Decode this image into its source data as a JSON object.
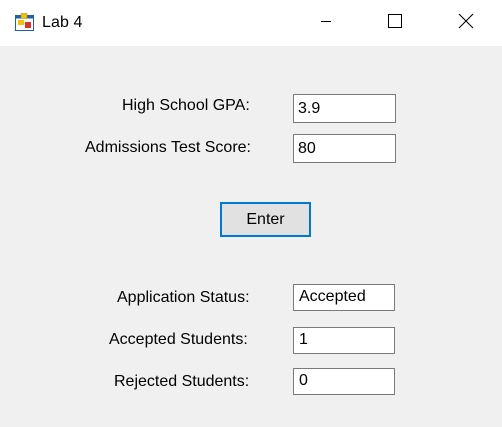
{
  "window": {
    "title": "Lab 4",
    "icon": "winforms-app-icon",
    "controls": {
      "minimize_icon": "minimize-icon",
      "maximize_icon": "maximize-icon",
      "close_icon": "close-icon"
    }
  },
  "form": {
    "gpa": {
      "label": "High School GPA:",
      "value": "3.9"
    },
    "test_score": {
      "label": "Admissions Test Score:",
      "value": "80"
    },
    "enter_button": {
      "label": "Enter"
    },
    "application_status": {
      "label": "Application Status:",
      "value": "Accepted"
    },
    "accepted_students": {
      "label": "Accepted Students:",
      "value": "1"
    },
    "rejected_students": {
      "label": "Rejected Students:",
      "value": "0"
    }
  },
  "colors": {
    "form_background": "#f0f0f0",
    "titlebar_background": "#ffffff",
    "focus_border": "#0078d7",
    "field_border": "#7a7a7a"
  }
}
